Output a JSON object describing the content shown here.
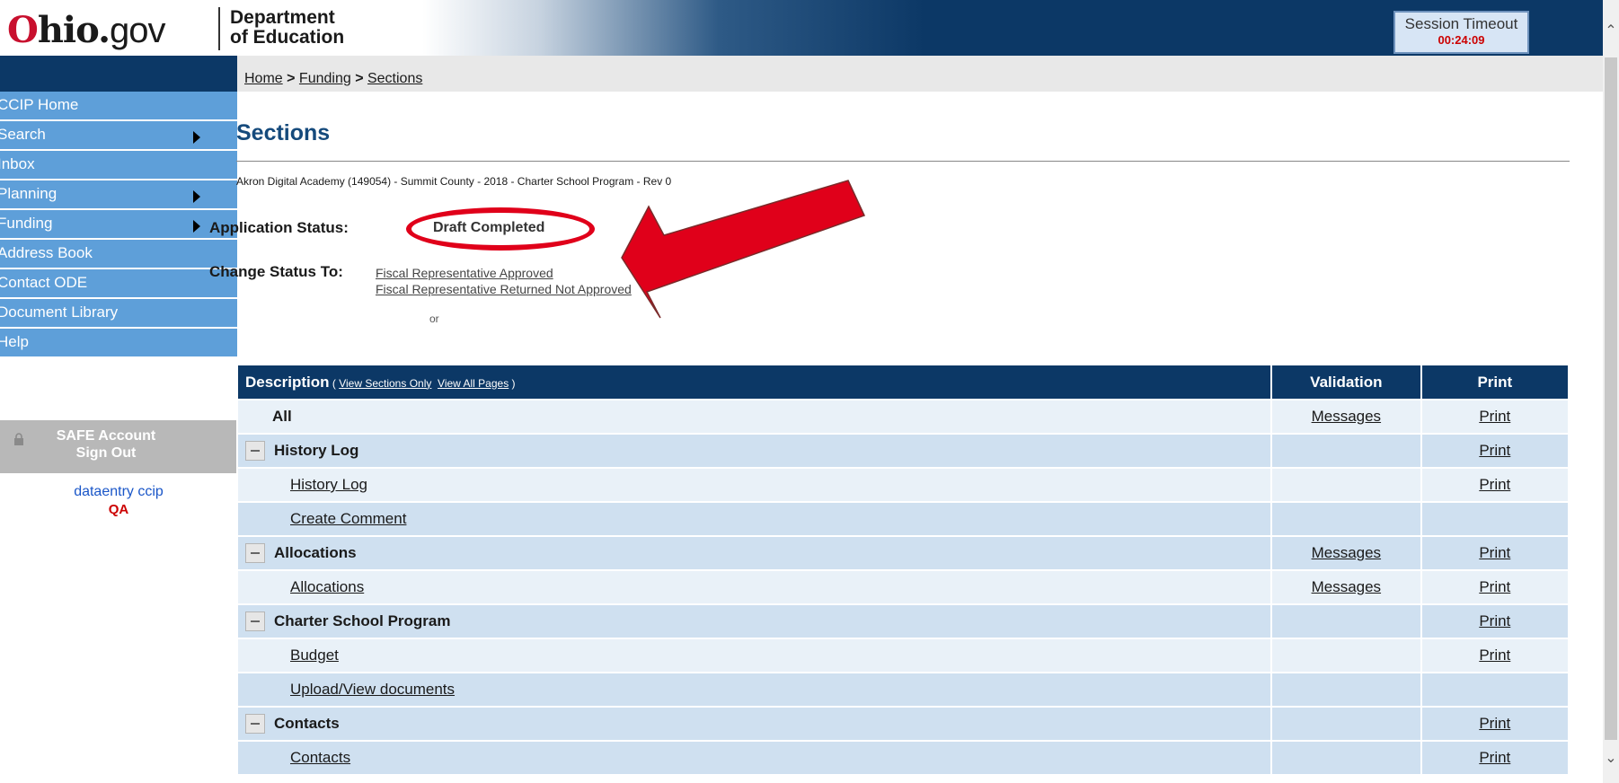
{
  "header": {
    "brand_o": "O",
    "brand_hio": "hio.",
    "brand_gov": "gov",
    "department_line1": "Department",
    "department_line2": "of Education",
    "session_label": "Session Timeout",
    "session_time": "00:24:09"
  },
  "breadcrumb": {
    "home": "Home",
    "sep1": " > ",
    "funding": "Funding",
    "sep2": " > ",
    "current": "Sections"
  },
  "sidebar": {
    "items": [
      {
        "label": "CCIP Home",
        "has_arrow": false
      },
      {
        "label": "Search",
        "has_arrow": true
      },
      {
        "label": "Inbox",
        "has_arrow": false
      },
      {
        "label": "Planning",
        "has_arrow": true
      },
      {
        "label": "Funding",
        "has_arrow": true
      },
      {
        "label": "Address Book",
        "has_arrow": false
      },
      {
        "label": "Contact ODE",
        "has_arrow": false
      },
      {
        "label": "Document Library",
        "has_arrow": false
      },
      {
        "label": "Help",
        "has_arrow": false
      }
    ],
    "safe_line1": "SAFE Account",
    "safe_line2": "Sign Out",
    "user_name": "dataentry ccip",
    "environment": "QA"
  },
  "page": {
    "title": "Sections",
    "context": "Akron Digital Academy (149054) - Summit County - 2018 - Charter School Program - Rev 0",
    "application_status_label": "Application Status:",
    "application_status_value": "Draft Completed",
    "change_status_label": "Change Status To:",
    "change_option_1": "Fiscal Representative Approved",
    "or_text": "or",
    "change_option_2": "Fiscal Representative Returned Not Approved"
  },
  "table": {
    "header_description": "Description",
    "header_paren_open": " ( ",
    "header_view_sections": "View Sections Only",
    "header_view_all": "View All Pages",
    "header_paren_close": " )",
    "header_validation": "Validation",
    "header_print": "Print",
    "rows": [
      {
        "type": "all",
        "label": "All",
        "validation": "Messages",
        "print": "Print"
      },
      {
        "type": "section",
        "label": "History Log",
        "validation": "",
        "print": "Print"
      },
      {
        "type": "page",
        "label": "History Log",
        "validation": "",
        "print": "Print"
      },
      {
        "type": "page",
        "label": "Create Comment",
        "validation": "",
        "print": ""
      },
      {
        "type": "section",
        "label": "Allocations",
        "validation": "Messages",
        "print": "Print"
      },
      {
        "type": "page",
        "label": "Allocations",
        "validation": "Messages",
        "print": "Print"
      },
      {
        "type": "section",
        "label": "Charter School Program",
        "validation": "",
        "print": "Print"
      },
      {
        "type": "page",
        "label": "Budget",
        "validation": "",
        "print": "Print"
      },
      {
        "type": "page",
        "label": "Upload/View documents",
        "validation": "",
        "print": ""
      },
      {
        "type": "section",
        "label": "Contacts",
        "validation": "",
        "print": "Print"
      },
      {
        "type": "page",
        "label": "Contacts",
        "validation": "",
        "print": "Print"
      }
    ]
  },
  "colors": {
    "navy": "#0c3866",
    "sidebar_blue": "#5e9fd9",
    "row_alt": "#cfe0f0",
    "row_norm": "#e9f1f8",
    "annotation_red": "#e0001a",
    "title_blue": "#154a7c"
  },
  "icons": {
    "collapse": "minus-box-icon",
    "submenu": "triangle-right-icon",
    "lock": "lock-icon",
    "scroll_up": "chevron-up-icon",
    "scroll_down": "chevron-down-icon"
  }
}
